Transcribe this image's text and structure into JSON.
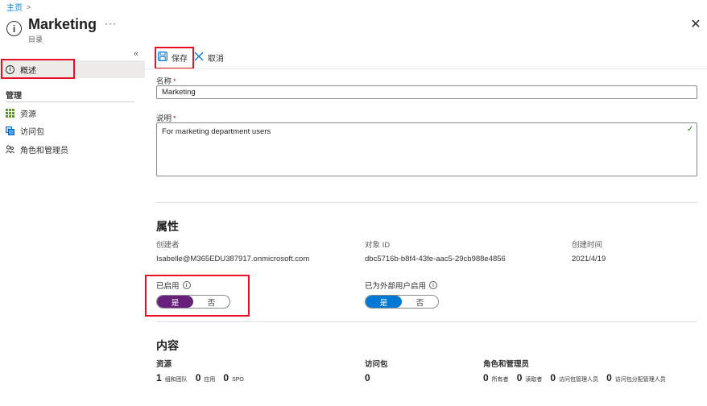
{
  "breadcrumb": {
    "home": "主页",
    "separator": ">"
  },
  "header": {
    "title": "Marketing",
    "subtitle": "目录",
    "more": "···",
    "close": "✕"
  },
  "sidebar": {
    "collapse": "«",
    "overview": "概述",
    "section": "管理",
    "items": [
      {
        "label": "资源",
        "icon": "grid-icon"
      },
      {
        "label": "访问包",
        "icon": "package-icon"
      },
      {
        "label": "角色和管理员",
        "icon": "people-icon"
      }
    ]
  },
  "toolbar": {
    "save_label": "保存",
    "cancel_label": "取消"
  },
  "form": {
    "name_label": "名称",
    "name_value": "Marketing",
    "desc_label": "说明",
    "desc_value": "For marketing department users",
    "required_mark": "*"
  },
  "properties": {
    "title": "属性",
    "creator_label": "创建者",
    "creator_value": "Isabelle@M365EDU387917.onmicrosoft.com",
    "object_id_label": "对象 ID",
    "object_id_value": "dbc5716b-b8f4-43fe-aac5-29cb988e4856",
    "created_label": "创建时间",
    "created_value": "2021/4/19",
    "enabled_label": "已启用",
    "external_label": "已为外部用户启用",
    "yes": "是",
    "no": "否"
  },
  "content": {
    "title": "内容",
    "resources_label": "资源",
    "resources": [
      {
        "num": "1",
        "label": "组和团队"
      },
      {
        "num": "0",
        "label": "应用"
      },
      {
        "num": "0",
        "label": "SPO"
      }
    ],
    "packages_label": "访问包",
    "packages_value": "0",
    "roles_label": "角色和管理员",
    "roles": [
      {
        "num": "0",
        "label": "所有者"
      },
      {
        "num": "0",
        "label": "读取者"
      },
      {
        "num": "0",
        "label": "访问包管理人员"
      },
      {
        "num": "0",
        "label": "访问包分配管理人员"
      }
    ]
  },
  "colors": {
    "accent": "#0078d4",
    "purple": "#68217a",
    "highlight": "#e81123"
  }
}
